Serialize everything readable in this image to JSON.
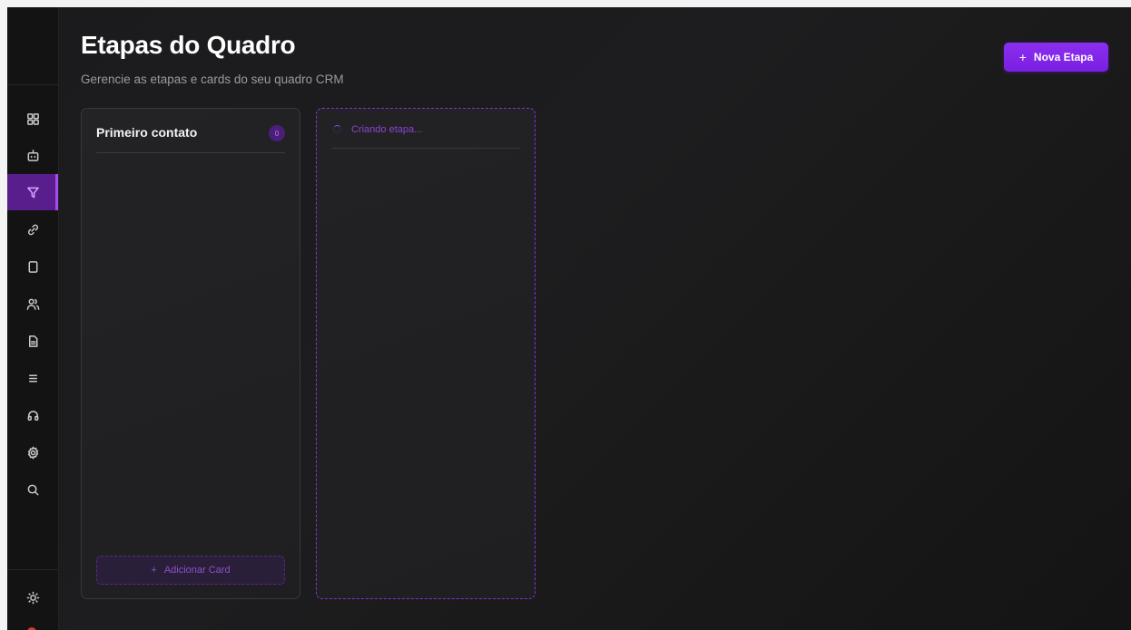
{
  "header": {
    "title": "Etapas do Quadro",
    "subtitle": "Gerencie as etapas e cards do seu quadro CRM",
    "new_stage_icon": "+",
    "new_stage_label": "Nova Etapa"
  },
  "sidebar": {
    "items": [
      {
        "icon": "grid-icon",
        "active": false
      },
      {
        "icon": "bot-icon",
        "active": false
      },
      {
        "icon": "funnel-icon",
        "active": true
      },
      {
        "icon": "link-icon",
        "active": false
      },
      {
        "icon": "phone-icon",
        "active": false
      },
      {
        "icon": "users-icon",
        "active": false
      },
      {
        "icon": "file-icon",
        "active": false
      },
      {
        "icon": "list-icon",
        "active": false
      },
      {
        "icon": "headset-icon",
        "active": false
      },
      {
        "icon": "settings-icon",
        "active": false
      },
      {
        "icon": "search-icon",
        "active": false
      }
    ],
    "theme_icon": "sun-icon"
  },
  "stages": [
    {
      "title": "Primeiro contato",
      "count": "0",
      "add_card_icon": "+",
      "add_card_label": "Adicionar Card"
    }
  ],
  "creating": {
    "label": "Criando etapa..."
  },
  "colors": {
    "accent": "#7a1fe0",
    "active_nav": "#5a1e8c",
    "background": "#1b1b1d"
  }
}
